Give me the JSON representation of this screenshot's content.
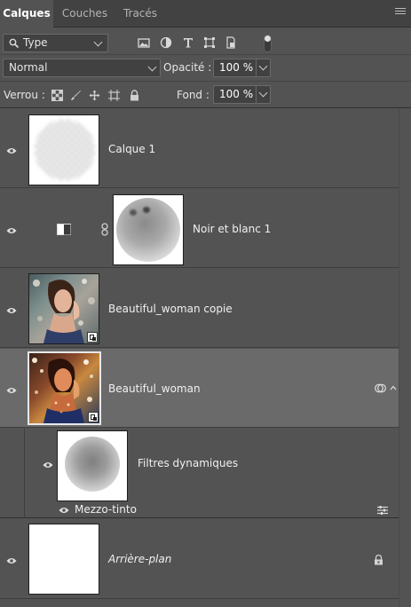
{
  "tabs": [
    {
      "label": "Calques",
      "active": true
    },
    {
      "label": "Couches",
      "active": false
    },
    {
      "label": "Tracés",
      "active": false
    }
  ],
  "filter": {
    "kind_label": "Type",
    "icons": [
      "image-filter-icon",
      "adjustment-filter-icon",
      "type-filter-icon",
      "shape-filter-icon",
      "smart-object-filter-icon"
    ]
  },
  "blend": {
    "mode": "Normal",
    "opacity_label": "Opacité :",
    "opacity_value": "100 %"
  },
  "lock": {
    "label": "Verrou :",
    "icons": [
      "lock-transparent-pixels-icon",
      "lock-image-pixels-icon",
      "lock-position-icon",
      "lock-artboard-icon",
      "lock-all-icon"
    ],
    "fill_label": "Fond :",
    "fill_value": "100 %"
  },
  "layers": [
    {
      "name": "Calque 1",
      "kind": "pixel",
      "visible": true,
      "selected": false
    },
    {
      "name": "Noir et blanc 1",
      "kind": "adjustment",
      "visible": true,
      "selected": false
    },
    {
      "name": "Beautiful_woman  copie",
      "kind": "smart-object",
      "visible": true,
      "selected": false
    },
    {
      "name": "Beautiful_woman",
      "kind": "smart-object",
      "visible": true,
      "selected": true,
      "expanded": true
    },
    {
      "name": "Filtres dynamiques",
      "kind": "smart-filter",
      "visible": true,
      "selected": false
    },
    {
      "name": "Mezzo-tinto",
      "kind": "filter",
      "visible": true,
      "selected": false
    },
    {
      "name": "Arrière-plan",
      "kind": "background",
      "visible": true,
      "locked": true,
      "selected": false
    }
  ],
  "colors": {
    "panel_bg": "#535353",
    "tab_bar_bg": "#424242",
    "selected_row": "#6a6a6a",
    "field_bg": "#414141"
  }
}
